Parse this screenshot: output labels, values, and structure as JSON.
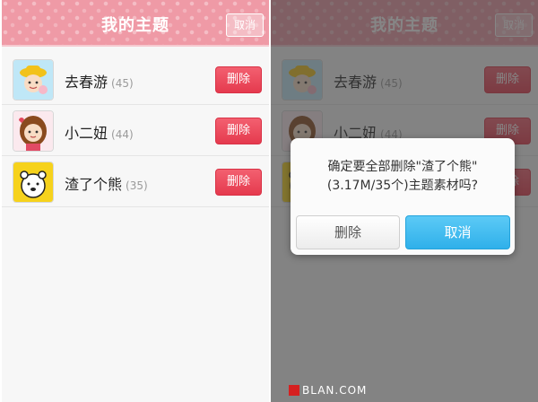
{
  "header": {
    "title": "我的主题",
    "cancel_label": "取消"
  },
  "themes": [
    {
      "name": "去春游",
      "count": "(45)",
      "delete_label": "删除"
    },
    {
      "name": "小二妞",
      "count": "(44)",
      "delete_label": "删除"
    },
    {
      "name": "渣了个熊",
      "count": "(35)",
      "delete_label": "删除"
    }
  ],
  "dialog": {
    "message_line1": "确定要全部删除\"渣了个熊\"",
    "message_line2": "(3.17M/35个)主题素材吗?",
    "delete_label": "删除",
    "cancel_label": "取消"
  },
  "watermark": {
    "text": "BLAN.COM"
  },
  "colors": {
    "header": "#ef9aa6",
    "delete": "#e53a4e",
    "dialog_confirm": "#2fb0ea"
  },
  "icons": [
    "cartoon-boy-hat-icon",
    "cartoon-girl-icon",
    "cartoon-bear-icon"
  ]
}
